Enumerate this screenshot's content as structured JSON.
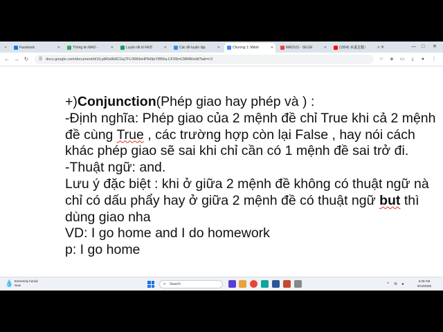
{
  "browser": {
    "tabs": [
      {
        "label": "Facebook",
        "favicon_color": "#1877f2",
        "active": false
      },
      {
        "label": "Thông tin MAD - Gi...",
        "favicon_color": "#34a853",
        "active": false
      },
      {
        "label": "Luyện đề lò FA25 -...",
        "favicon_color": "#0f9d58",
        "active": false
      },
      {
        "label": "Các đề luyện tập cố...",
        "favicon_color": "#4285f4",
        "active": false
      },
      {
        "label": "Chương 1: Mệnh đề -...",
        "favicon_color": "#4285f4",
        "active": true
      },
      {
        "label": "MAD101 - SE19A -...",
        "favicon_color": "#ea4335",
        "active": false
      },
      {
        "label": "(1054) 水溪主题 Ker...",
        "favicon_color": "#ff0000",
        "active": false
      }
    ],
    "url": "docs.google.com/document/d/1lLpM0s8k8CGq7FL0WNoHPtH9pY8B6q-CF99mCMM8/edit?tab=t.0"
  },
  "document": {
    "lines": [
      [
        {
          "t": "+)"
        },
        {
          "t": "Conjunction",
          "b": true
        },
        {
          "t": "(Phép giao hay phép và ) :"
        }
      ],
      [
        {
          "t": "-Định nghĩa: Phép giao của 2 mệnh đề chỉ True khi cả 2 mệnh"
        }
      ],
      [
        {
          "t": "đề cùng "
        },
        {
          "t": "True",
          "w": true
        },
        {
          "t": " , các trường hợp còn lại False , hay nói cách"
        }
      ],
      [
        {
          "t": "khác phép giao sẽ sai khi chỉ cần có 1 mệnh đề sai trở đi."
        }
      ],
      [
        {
          "t": "-Thuật ngữ: and."
        }
      ],
      [
        {
          "t": "Lưu ý đặc biệt : khi ở giữa 2 mệnh đề không có thuật ngữ nà"
        }
      ],
      [
        {
          "t": "chỉ có dấu phẩy hay ở giữa 2 mệnh đề có thuật ngữ "
        },
        {
          "t": "but",
          "b": true,
          "w": true
        },
        {
          "t": " thì"
        }
      ],
      [
        {
          "t": "dùng giao nha"
        }
      ],
      [
        {
          "t": "VD: I go home and I do homework"
        }
      ],
      [
        {
          "t": "p: I go home"
        }
      ]
    ]
  },
  "taskbar": {
    "weather_title": "Extremely humid",
    "weather_sub": "Now",
    "search_placeholder": "Search",
    "time": "6:29 AM",
    "date": "9/13/2025"
  }
}
